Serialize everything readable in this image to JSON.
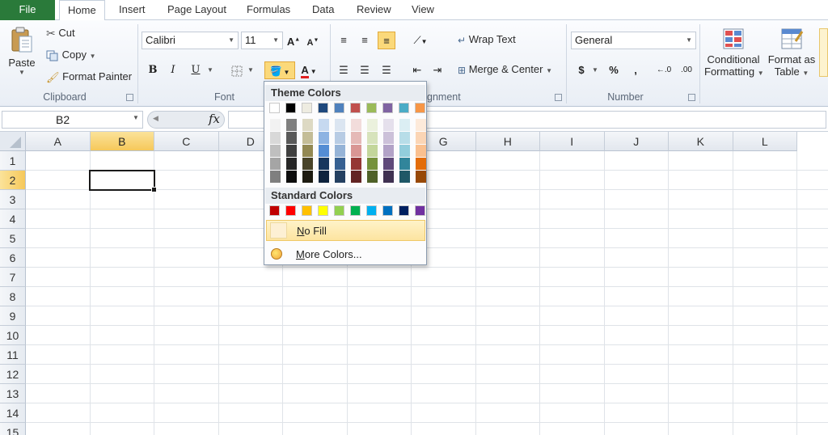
{
  "tabs": [
    "File",
    "Home",
    "Insert",
    "Page Layout",
    "Formulas",
    "Data",
    "Review",
    "View"
  ],
  "active_tab": "Home",
  "clipboard": {
    "label": "Clipboard",
    "paste": "Paste",
    "cut": "Cut",
    "copy": "Copy",
    "format_painter": "Format Painter"
  },
  "font": {
    "label": "Font",
    "name": "Calibri",
    "size": "11",
    "bold": "B",
    "italic": "I",
    "underline": "U"
  },
  "alignment": {
    "label": "gnment",
    "wrap_text": "Wrap Text",
    "merge_center": "Merge & Center"
  },
  "number": {
    "label": "Number",
    "format": "General",
    "currency": "$",
    "percent": "%",
    "comma": ","
  },
  "styles": {
    "conditional_1": "Conditional",
    "conditional_2": "Formatting",
    "format_table_1": "Format as",
    "format_table_2": "Table"
  },
  "formula_bar": {
    "name_box": "B2",
    "fx": "fx",
    "value": ""
  },
  "columns": [
    "A",
    "B",
    "C",
    "D",
    "E",
    "F",
    "G",
    "H",
    "I",
    "J",
    "K",
    "L"
  ],
  "rows": [
    "1",
    "2",
    "3",
    "4",
    "5",
    "6",
    "7",
    "8",
    "9",
    "10",
    "11",
    "12",
    "13",
    "14",
    "15"
  ],
  "selected_column": "B",
  "selected_row": "2",
  "color_menu": {
    "theme_title": "Theme Colors",
    "standard_title": "Standard Colors",
    "no_fill_key": "N",
    "no_fill_rest": "o Fill",
    "more_key": "M",
    "more_rest": "ore Colors...",
    "theme_colors": [
      "#ffffff",
      "#000000",
      "#eeece1",
      "#1f497d",
      "#4f81bd",
      "#c0504d",
      "#9bbb59",
      "#8064a2",
      "#4bacc6",
      "#f79646"
    ],
    "theme_shades": [
      [
        "#f2f2f2",
        "#d8d8d8",
        "#bfbfbf",
        "#a5a5a5",
        "#7f7f7f"
      ],
      [
        "#7f7f7f",
        "#595959",
        "#3f3f3f",
        "#262626",
        "#0c0c0c"
      ],
      [
        "#ddd9c3",
        "#c4bd97",
        "#938953",
        "#494429",
        "#1d1b10"
      ],
      [
        "#c6d9f0",
        "#8db3e2",
        "#548dd4",
        "#17365d",
        "#0f243e"
      ],
      [
        "#dbe5f1",
        "#b8cce4",
        "#95b3d7",
        "#366092",
        "#244061"
      ],
      [
        "#f2dcdb",
        "#e5b9b7",
        "#d99694",
        "#953734",
        "#632423"
      ],
      [
        "#ebf1dd",
        "#d7e3bc",
        "#c3d69b",
        "#76923c",
        "#4f6128"
      ],
      [
        "#e5e0ec",
        "#ccc1d9",
        "#b2a2c7",
        "#5f497a",
        "#3f3151"
      ],
      [
        "#dbeef3",
        "#b7dde8",
        "#92cddc",
        "#31859b",
        "#205867"
      ],
      [
        "#fdeada",
        "#fbd5b5",
        "#fac08f",
        "#e36c09",
        "#974806"
      ]
    ],
    "standard_colors": [
      "#c00000",
      "#ff0000",
      "#ffc000",
      "#ffff00",
      "#92d050",
      "#00b050",
      "#00b0f0",
      "#0070c0",
      "#002060",
      "#7030a0"
    ]
  }
}
